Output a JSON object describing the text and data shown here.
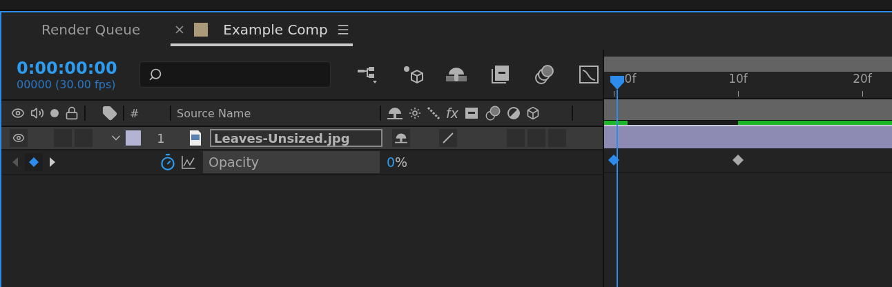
{
  "tabs": [
    {
      "label": "Render Queue",
      "selected": false
    },
    {
      "label": "Example Comp",
      "selected": true,
      "color": "#ab9a7a"
    }
  ],
  "timecode": {
    "time": "0:00:00:00",
    "frames": "00000 (30.00 fps)"
  },
  "columns": {
    "number": "#",
    "source": "Source Name",
    "effects": "fx"
  },
  "layer": {
    "visible": true,
    "expanded": true,
    "color": "#b3b3d3",
    "number": "1",
    "source_name": "Leaves-Unsized.jpg",
    "shy_on": true,
    "quality_on": true
  },
  "property": {
    "name": "Opacity",
    "value": "0",
    "unit": "%",
    "stopwatch_on": true
  },
  "ruler": [
    "0f",
    "10f",
    "20f"
  ],
  "keyframes": [
    {
      "selected": true
    },
    {
      "selected": false
    }
  ]
}
